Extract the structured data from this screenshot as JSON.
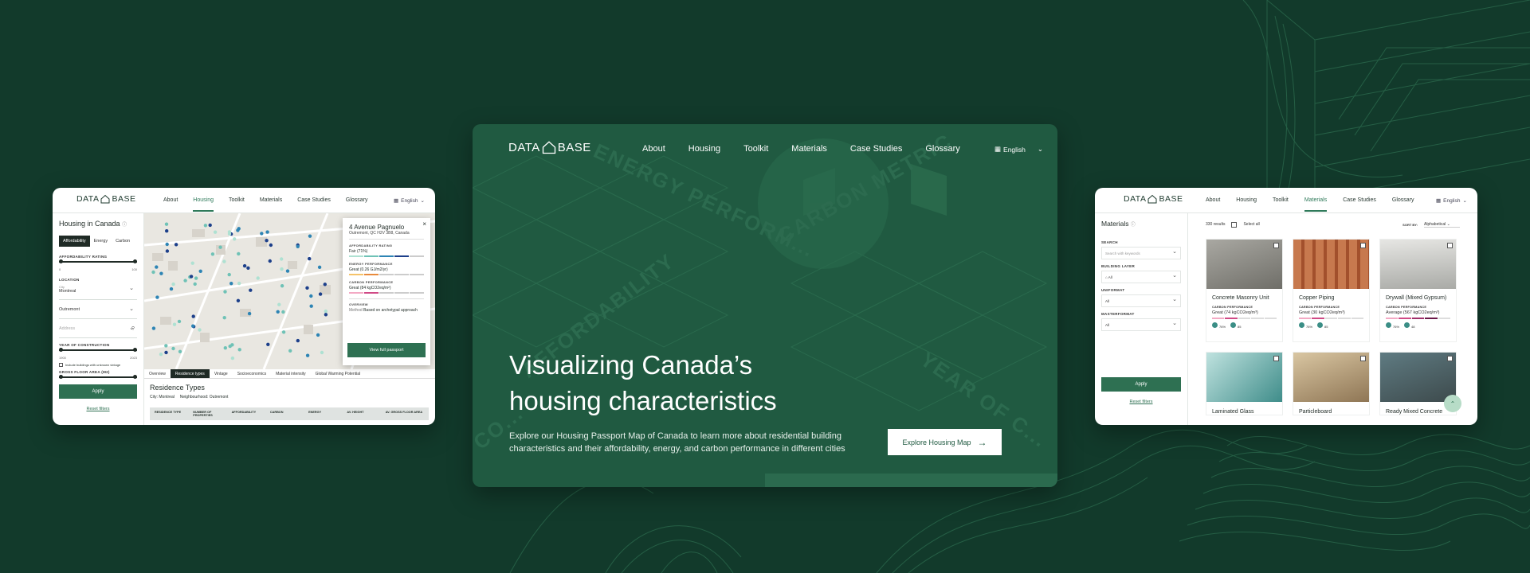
{
  "colors": {
    "background": "#123a2b",
    "hero": "#205a41",
    "accent": "#2e7052",
    "white": "#ffffff"
  },
  "left_card": {
    "logo_left": "DATA",
    "logo_right": "BASE",
    "nav": [
      "About",
      "Housing",
      "Toolkit",
      "Materials",
      "Case Studies",
      "Glossary"
    ],
    "active_nav": "Housing",
    "language": "English",
    "sidebar": {
      "title": "Housing in Canada",
      "tabs": [
        "Affordability",
        "Energy",
        "Carbon"
      ],
      "affordability_label": "AFFORDABILITY RATING",
      "range_min": "0",
      "range_max": "100",
      "location_label": "LOCATION",
      "city_small": "City",
      "city_value": "Montreal",
      "neighbourhood_value": "Outremont",
      "address_placeholder": "Address",
      "year_label": "YEAR OF CONSTRUCTION",
      "year_min": "1900",
      "year_max": "2023",
      "unknown_years": "Include buildings with unknown vintage",
      "gfa_label": "GROSS FLOOR AREA (M2)",
      "apply": "Apply",
      "reset": "Reset filters"
    },
    "popup": {
      "title": "4 Avenue Pagnuelo",
      "subtitle": "Outremont, QC H2V 3B8, Canada",
      "afford_label": "AFFORDABILITY RATING",
      "afford_value": "Fair (71%)",
      "energy_label": "ENERGY PERFORMANCE",
      "energy_value": "Great (0.26 GJ/m2/yr)",
      "carbon_label": "CARBON PERFORMANCE",
      "carbon_value": "Great (84 kgCO2eq/m²)",
      "overview_label": "OVERVIEW",
      "method_key": "Method",
      "method_value": "Based on archetypal approach",
      "button": "View full passport"
    },
    "tabs": [
      "Overview",
      "Residence types",
      "Vintage",
      "Socioeconomics",
      "Material intensity",
      "Global Warming Potential"
    ],
    "active_tab": "Residence types",
    "residence": {
      "title": "Residence Types",
      "city_key": "City:",
      "city_val": "Montreal",
      "nbh_key": "Neighbourhood:",
      "nbh_val": "Outremont",
      "headers": [
        "RESIDENCE TYPE",
        "NUMBER OF PROPERTIES",
        "AFFORDABILITY",
        "CARBON",
        "ENERGY",
        "AV. HEIGHT",
        "AV. GROSS FLOOR AREA"
      ]
    }
  },
  "center_card": {
    "logo_left": "DATA",
    "logo_right": "BASE",
    "nav": [
      "About",
      "Housing",
      "Toolkit",
      "Materials",
      "Case Studies",
      "Glossary"
    ],
    "language": "English",
    "watermark": [
      "ENERGY PERFORM...",
      "CARBON METRIC",
      "AFFORDABILITY",
      "YEAR OF C...",
      "CO..."
    ],
    "hero_title_line1": "Visualizing Canada’s",
    "hero_title_line2": "housing characteristics",
    "hero_text": "Explore our Housing Passport Map of Canada to learn more about residential building characteristics and their affordability, energy, and carbon performance in different cities",
    "cta": "Explore Housing Map"
  },
  "right_card": {
    "logo_left": "DATA",
    "logo_right": "BASE",
    "nav": [
      "About",
      "Housing",
      "Toolkit",
      "Materials",
      "Case Studies",
      "Glossary"
    ],
    "active_nav": "Materials",
    "language": "English",
    "sidebar": {
      "title": "Materials",
      "search_label": "SEARCH",
      "search_placeholder": "Search with keywords",
      "layer_label": "BUILDING LAYER",
      "layer_value": "All",
      "uniformat_label": "UNIFORMAT",
      "uniformat_value": "All",
      "masterformat_label": "MASTERFORMAT",
      "masterformat_value": "All",
      "apply": "Apply",
      "reset": "Reset filters"
    },
    "results": "330 results",
    "select_all": "Select all",
    "sort_label": "SORT BY:",
    "sort_value": "Alphabetical",
    "products": [
      {
        "name": "Concrete Masonry Unit",
        "perf_label": "CARBON PERFORMANCE",
        "perf": "Great (74 kgCO2eq/m³)",
        "a": "76%",
        "b": "85",
        "img": "#8f8f8a"
      },
      {
        "name": "Copper Piping",
        "perf_label": "CARBON PERFORMANCE",
        "perf": "Great (30 kgCO2eq/m³)",
        "a": "76%",
        "b": "85",
        "img": "#b9683f"
      },
      {
        "name": "Drywall (Mixed Gypsum)",
        "perf_label": "CARBON PERFORMANCE",
        "perf": "Average (567 kgCO2eq/m³)",
        "a": "76%",
        "b": "48",
        "img": "#c9c9c6"
      }
    ],
    "products2": [
      {
        "name": "Laminated Glass",
        "img": "#7fb7b4"
      },
      {
        "name": "Particleboard",
        "img": "#b59f7a"
      },
      {
        "name": "Ready Mixed Concrete",
        "img": "#5a6a68"
      }
    ]
  }
}
